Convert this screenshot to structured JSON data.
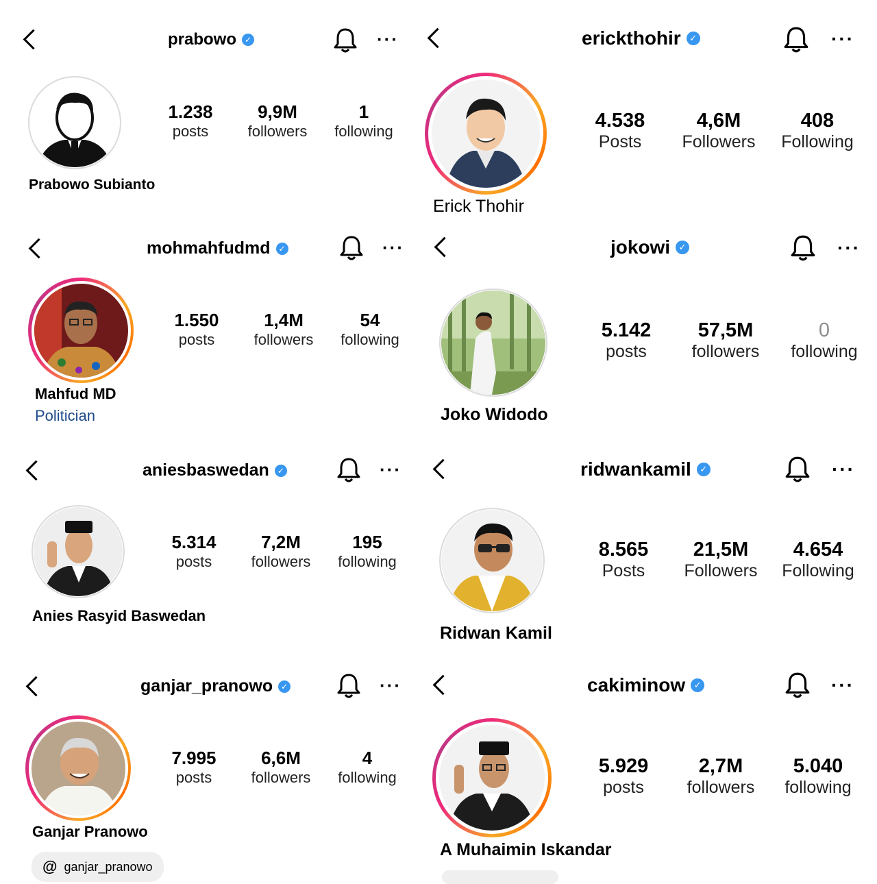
{
  "profiles": [
    {
      "username": "prabowo",
      "full_name": "Prabowo Subianto",
      "posts": "1.238",
      "followers": "9,9M",
      "following": "1",
      "posts_label": "posts",
      "followers_label": "followers",
      "following_label": "following"
    },
    {
      "username": "erickthohir",
      "full_name": "Erick Thohir",
      "posts": "4.538",
      "followers": "4,6M",
      "following": "408",
      "posts_label": "Posts",
      "followers_label": "Followers",
      "following_label": "Following"
    },
    {
      "username": "mohmahfudmd",
      "full_name": "Mahfud MD",
      "category": "Politician",
      "posts": "1.550",
      "followers": "1,4M",
      "following": "54",
      "posts_label": "posts",
      "followers_label": "followers",
      "following_label": "following"
    },
    {
      "username": "jokowi",
      "full_name": "Joko Widodo",
      "posts": "5.142",
      "followers": "57,5M",
      "following": "0",
      "posts_label": "posts",
      "followers_label": "followers",
      "following_label": "following"
    },
    {
      "username": "aniesbaswedan",
      "full_name": "Anies Rasyid Baswedan",
      "posts": "5.314",
      "followers": "7,2M",
      "following": "195",
      "posts_label": "posts",
      "followers_label": "followers",
      "following_label": "following"
    },
    {
      "username": "ridwankamil",
      "full_name": "Ridwan Kamil",
      "posts": "8.565",
      "followers": "21,5M",
      "following": "4.654",
      "posts_label": "Posts",
      "followers_label": "Followers",
      "following_label": "Following"
    },
    {
      "username": "ganjar_pranowo",
      "full_name": "Ganjar Pranowo",
      "threads": "ganjar_pranowo",
      "posts": "7.995",
      "followers": "6,6M",
      "following": "4",
      "posts_label": "posts",
      "followers_label": "followers",
      "following_label": "following"
    },
    {
      "username": "cakiminow",
      "full_name": "A Muhaimin Iskandar",
      "posts": "5.929",
      "followers": "2,7M",
      "following": "5.040",
      "posts_label": "posts",
      "followers_label": "followers",
      "following_label": "following"
    }
  ],
  "icons": {
    "back": "chevron-left-icon",
    "verified": "verified-badge-icon",
    "bell": "bell-icon",
    "more": "more-options-icon",
    "threads": "threads-icon"
  },
  "colors": {
    "verified": "#3897f0",
    "story_ring": "#ee2a7b",
    "category": "#1e4a8a"
  }
}
